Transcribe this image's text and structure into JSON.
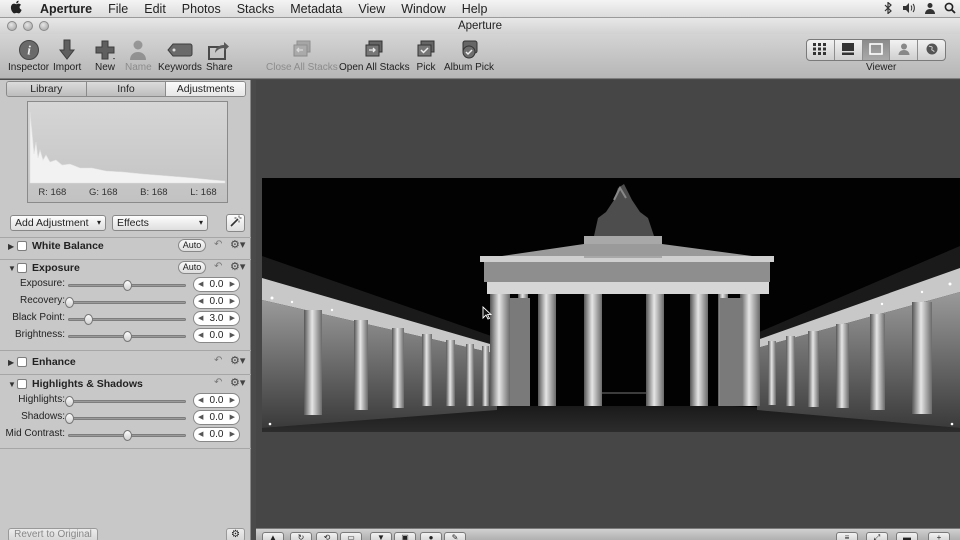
{
  "menubar": {
    "apple": "",
    "items": [
      "Aperture",
      "File",
      "Edit",
      "Photos",
      "Stacks",
      "Metadata",
      "View",
      "Window",
      "Help"
    ]
  },
  "window": {
    "title": "Aperture"
  },
  "toolbar": {
    "inspector": "Inspector",
    "import": "Import",
    "new": "New",
    "name": "Name",
    "keywords": "Keywords",
    "share": "Share",
    "close_all_stacks": "Close All Stacks",
    "open_all_stacks": "Open All Stacks",
    "pick": "Pick",
    "album_pick": "Album Pick",
    "viewer": "Viewer"
  },
  "inspector": {
    "tabs": [
      "Library",
      "Info",
      "Adjustments"
    ],
    "active_tab": "Adjustments",
    "histogram": {
      "r": "R: 168",
      "g": "G: 168",
      "b": "B: 168",
      "l": "L: 168"
    },
    "add_adjustment": "Add Adjustment",
    "effects": "Effects",
    "bricks": {
      "white_balance": {
        "title": "White Balance",
        "auto": "Auto"
      },
      "exposure": {
        "title": "Exposure",
        "auto": "Auto",
        "sliders": [
          {
            "label": "Exposure:",
            "value": "0.0",
            "pos": 0.5
          },
          {
            "label": "Recovery:",
            "value": "0.0",
            "pos": 0.0
          },
          {
            "label": "Black Point:",
            "value": "3.0",
            "pos": 0.16
          },
          {
            "label": "Brightness:",
            "value": "0.0",
            "pos": 0.5
          }
        ]
      },
      "enhance": {
        "title": "Enhance"
      },
      "highlights_shadows": {
        "title": "Highlights & Shadows",
        "sliders": [
          {
            "label": "Highlights:",
            "value": "0.0",
            "pos": 0.0
          },
          {
            "label": "Shadows:",
            "value": "0.0",
            "pos": 0.0
          },
          {
            "label": "Mid Contrast:",
            "value": "0.0",
            "pos": 0.5
          }
        ]
      }
    },
    "revert": "Revert to Original"
  },
  "colors": {
    "panel": "#c8c8c8",
    "viewer_bg": "#464646",
    "photo_bg": "#000000"
  }
}
